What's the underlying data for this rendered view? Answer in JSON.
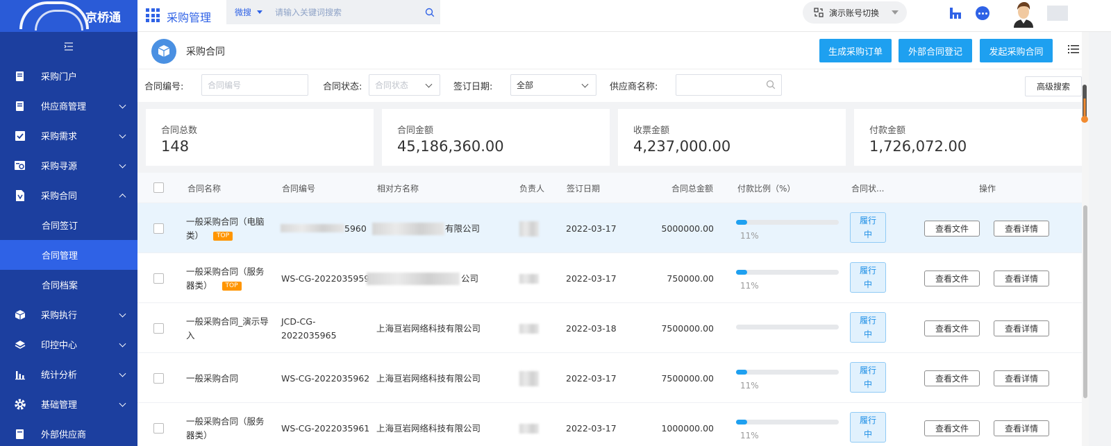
{
  "brand": {
    "name": "京桥通"
  },
  "sidebar": {
    "items": [
      {
        "label": "采购门户",
        "icon": "portal-icon"
      },
      {
        "label": "供应商管理",
        "icon": "supplier-icon"
      },
      {
        "label": "采购需求",
        "icon": "demand-icon"
      },
      {
        "label": "采购寻源",
        "icon": "sourcing-icon"
      },
      {
        "label": "采购合同",
        "icon": "contract-icon"
      },
      {
        "label": "采购执行",
        "icon": "cube-icon"
      },
      {
        "label": "印控中心",
        "icon": "layers-icon"
      },
      {
        "label": "统计分析",
        "icon": "bar-chart-icon"
      },
      {
        "label": "基础管理",
        "icon": "gear-icon"
      },
      {
        "label": "外部供应商",
        "icon": "external-icon"
      }
    ],
    "sub_items": [
      {
        "label": "合同签订"
      },
      {
        "label": "合同管理"
      },
      {
        "label": "合同档案"
      }
    ]
  },
  "topbar": {
    "app_title": "采购管理",
    "search_type": "微搜",
    "search_placeholder": "请输入关键词搜索",
    "account_switch": "演示账号切换"
  },
  "page": {
    "title": "采购合同",
    "buttons": {
      "generate_order": "生成采购订单",
      "external_register": "外部合同登记",
      "start_contract": "发起采购合同"
    }
  },
  "filters": {
    "contract_no_label": "合同编号:",
    "contract_no_placeholder": "合同编号",
    "status_label": "合同状态:",
    "status_placeholder": "合同状态",
    "sign_date_label": "签订日期:",
    "sign_date_value": "全部",
    "supplier_label": "供应商名称:",
    "advanced_search": "高级搜索"
  },
  "stats": [
    {
      "label": "合同总数",
      "value": "148"
    },
    {
      "label": "合同金额",
      "value": "45,186,360.00"
    },
    {
      "label": "收票金额",
      "value": "4,237,000.00"
    },
    {
      "label": "付款金额",
      "value": "1,726,072.00"
    }
  ],
  "table": {
    "headers": {
      "name": "合同名称",
      "number": "合同编号",
      "counterparty": "相对方名称",
      "owner": "负责人",
      "sign_date": "签订日期",
      "amount": "合同总金额",
      "pay_ratio": "付款比例（%）",
      "status": "合同状...",
      "action": "操作"
    },
    "top_badge": "TOP",
    "view_file": "查看文件",
    "view_detail": "查看详情",
    "rows": [
      {
        "name_line1": "一般采购合同（电脑",
        "name_line2": "类）",
        "top": true,
        "number_line1": "5960",
        "number_line2": "",
        "counterparty": "有限公司",
        "sign_date": "2022-03-17",
        "amount": "5000000.00",
        "pay_pct": 11,
        "pct_text": "11%",
        "status_line1": "履行",
        "status_line2": "中"
      },
      {
        "name_line1": "一般采购合同（服务",
        "name_line2": "器类）",
        "top": true,
        "number_line1": "WS-CG-2022035959",
        "number_line2": "",
        "counterparty": "公司",
        "sign_date": "2022-03-17",
        "amount": "750000.00",
        "pay_pct": 11,
        "pct_text": "11%",
        "status_line1": "履行",
        "status_line2": "中"
      },
      {
        "name_line1": "一般采购合同_演示导",
        "name_line2": "入",
        "top": false,
        "number_line1": "JCD-CG-",
        "number_line2": "2022035965",
        "counterparty": "上海亘岩网络科技有限公司",
        "sign_date": "2022-03-18",
        "amount": "7500000.00",
        "pay_pct": 0,
        "pct_text": "",
        "status_line1": "履行",
        "status_line2": "中"
      },
      {
        "name_line1": "一般采购合同",
        "name_line2": "",
        "top": false,
        "number_line1": "WS-CG-2022035962",
        "number_line2": "",
        "counterparty": "上海亘岩网络科技有限公司",
        "sign_date": "2022-03-17",
        "amount": "7500000.00",
        "pay_pct": 11,
        "pct_text": "11%",
        "status_line1": "履行",
        "status_line2": "中"
      },
      {
        "name_line1": "一般采购合同（服务",
        "name_line2": "器类）",
        "top": false,
        "number_line1": "WS-CG-2022035961",
        "number_line2": "",
        "counterparty": "上海亘岩网络科技有限公司",
        "sign_date": "2022-03-17",
        "amount": "1000000.00",
        "pay_pct": 11,
        "pct_text": "11%",
        "status_line1": "履行",
        "status_line2": "中"
      }
    ]
  },
  "colors": {
    "sidebar": "#1c3f9f",
    "accent": "#2f62e6",
    "button": "#1ea0f0",
    "row_highlight": "#e9f4fd",
    "badge": "#ff9500"
  }
}
